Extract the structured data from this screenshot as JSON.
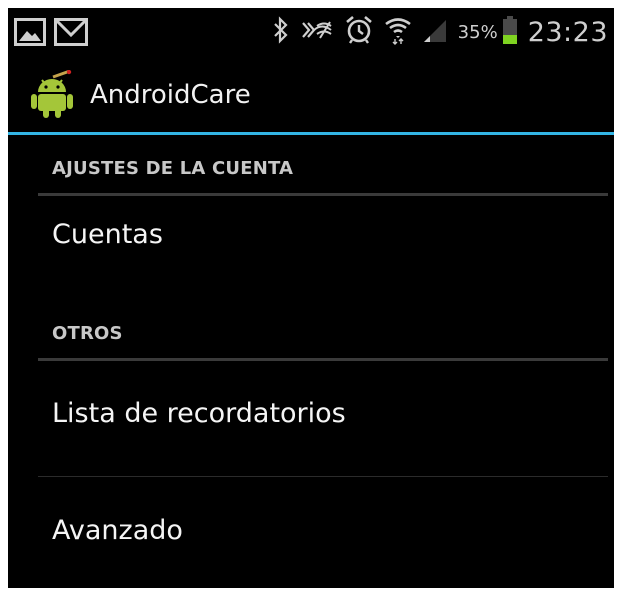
{
  "status_bar": {
    "left_icons": [
      "gallery-notification-icon",
      "gmail-notification-icon"
    ],
    "right_icons": [
      "bluetooth-icon",
      "nfc-icon",
      "alarm-icon",
      "wifi-icon",
      "signal-icon"
    ],
    "battery_percent": "35%",
    "battery_level": 0.35,
    "time": "23:23"
  },
  "action_bar": {
    "app_icon": "android-robot-icon",
    "title": "AndroidCare"
  },
  "sections": [
    {
      "header": "AJUSTES DE LA CUENTA",
      "items": [
        "Cuentas"
      ]
    },
    {
      "header": "OTROS",
      "items": [
        "Lista de recordatorios",
        "Avanzado"
      ]
    }
  ],
  "colors": {
    "background": "#000000",
    "accent": "#33b5e5",
    "android_green": "#a4c639",
    "battery_green": "#7fd321"
  }
}
